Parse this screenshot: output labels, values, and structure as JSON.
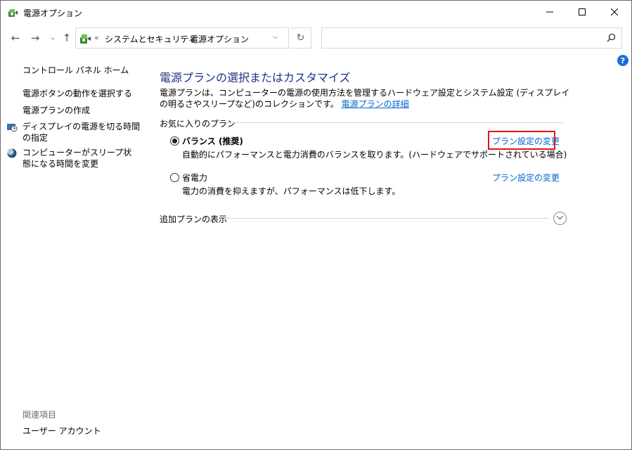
{
  "window": {
    "title": "電源オプション",
    "icon": "power-options-icon"
  },
  "address_bar": {
    "overflow": "«",
    "crumbs": [
      "システムとセキュリティ",
      "電源オプション"
    ],
    "search_placeholder": ""
  },
  "sidebar": {
    "home": "コントロール パネル ホーム",
    "links": [
      "電源ボタンの動作を選択する",
      "電源プランの作成",
      "ディスプレイの電源を切る時間の指定",
      "コンピューターがスリープ状態になる時間を変更"
    ],
    "related_heading": "関連項目",
    "related_links": [
      "ユーザー アカウント"
    ]
  },
  "main": {
    "title": "電源プランの選択またはカスタマイズ",
    "description": "電源プランは、コンピューターの電源の使用方法を管理するハードウェア設定とシステム設定 (ディスプレイの明るさやスリープなど)のコレクションです。",
    "description_link": "電源プランの詳細",
    "favorites_label": "お気に入りのプラン",
    "plans": [
      {
        "name": "バランス (推奨)",
        "desc": "自動的にパフォーマンスと電力消費のバランスを取ります。(ハードウェアでサポートされている場合)",
        "link": "プラン設定の変更",
        "selected": true
      },
      {
        "name": "省電力",
        "desc": "電力の消費を抑えますが、パフォーマンスは低下します。",
        "link": "プラン設定の変更",
        "selected": false
      }
    ],
    "more_plans_label": "追加プランの表示"
  },
  "colors": {
    "title": "#1e3287",
    "link": "#0066cc",
    "highlight": "#e0141b"
  }
}
